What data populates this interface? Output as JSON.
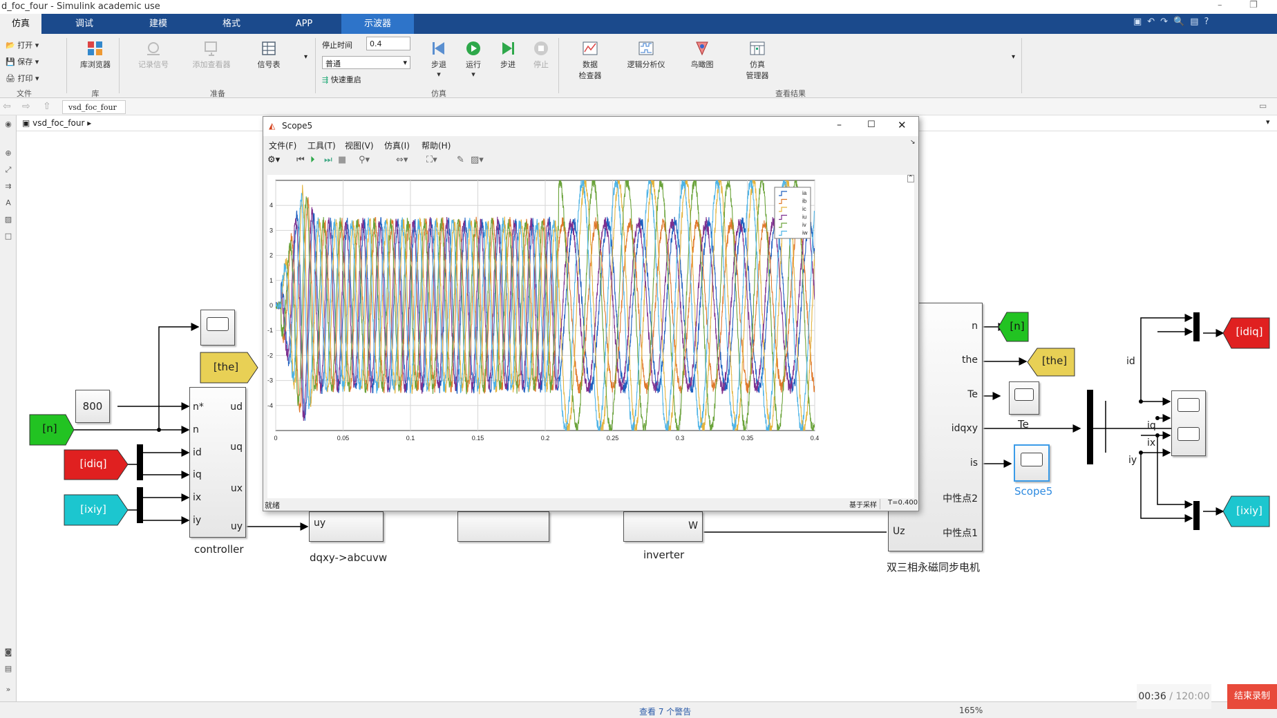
{
  "window_title": "d_foc_four - Simulink academic use",
  "tabs": [
    {
      "label": "仿真",
      "state": "active"
    },
    {
      "label": "调试",
      "state": "normal"
    },
    {
      "label": "建模",
      "state": "normal"
    },
    {
      "label": "格式",
      "state": "normal"
    },
    {
      "label": "APP",
      "state": "normal"
    },
    {
      "label": "示波器",
      "state": "highlight"
    }
  ],
  "ribbon": {
    "file": {
      "open": "打开",
      "save": "保存",
      "print": "打印",
      "label": "文件"
    },
    "library": {
      "browser": "库浏览器",
      "label": "库"
    },
    "prepare": {
      "log_signals": "记录信号",
      "add_viewer": "添加查看器",
      "signal_table": "信号表",
      "label": "准备"
    },
    "simulate": {
      "stop_time_label": "停止时间",
      "stop_time_value": "0.4",
      "mode_value": "普通",
      "fast_restart": "快速重启",
      "step_back": "步退",
      "run": "运行",
      "step_forward": "步进",
      "stop": "停止",
      "label": "仿真"
    },
    "review": {
      "data_inspector_line1": "数据",
      "data_inspector_line2": "检查器",
      "logic_analyzer": "逻辑分析仪",
      "bird_eye": "鸟瞰图",
      "sim_manager_line1": "仿真",
      "sim_manager_line2": "管理器",
      "label": "查看结果"
    }
  },
  "address": {
    "tab": "vsd_foc_four",
    "path": "vsd_foc_four"
  },
  "diagram": {
    "const_value": "800",
    "goto_n": "[n]",
    "goto_idiq": "[idiq]",
    "goto_ixiy": "[ixiy]",
    "goto_the": "[the]",
    "controller": {
      "name": "controller",
      "in": [
        "n*",
        "n",
        "id",
        "iq",
        "ix",
        "iy"
      ],
      "out": [
        "ud",
        "uq",
        "ux",
        "uy"
      ]
    },
    "dqxy_block": {
      "name": "dqxy->abcuvw",
      "port": "uy"
    },
    "inverter": {
      "name": "inverter",
      "port": "W"
    },
    "motor": {
      "name": "双三相永磁同步电机",
      "in": "Uz",
      "out": [
        "n",
        "the",
        "Te",
        "idqxy",
        "is",
        "中性点2",
        "中性点1"
      ]
    },
    "te_label": "Te",
    "scope5_label": "Scope5",
    "right": {
      "goto_n": "[n]",
      "goto_the": "[the]",
      "goto_idiq": "[idiq]",
      "goto_ixiy": "[ixiy]",
      "signals": [
        "id",
        "iq",
        "ix",
        "iy"
      ]
    }
  },
  "scope": {
    "title": "Scope5",
    "menus": [
      "文件(F)",
      "工具(T)",
      "视图(V)",
      "仿真(I)",
      "帮助(H)"
    ],
    "status_left": "就绪",
    "status_mid": "基于采样",
    "status_right": "T=0.400"
  },
  "chart_data": {
    "type": "line",
    "title": "",
    "xlabel": "",
    "ylabel": "",
    "xlim": [
      0,
      0.4
    ],
    "ylim": [
      -5,
      5
    ],
    "x_ticks": [
      "0",
      "0.05",
      "0.1",
      "0.15",
      "0.2",
      "0.25",
      "0.3",
      "0.35",
      "0.4"
    ],
    "y_ticks": [
      "4",
      "3",
      "2",
      "1",
      "0",
      "-1",
      "-2",
      "-3",
      "-4"
    ],
    "grid": true,
    "legend_position": "top-right",
    "series": [
      {
        "name": "ia",
        "color": "#1f5fbf",
        "amplitude": 3.3,
        "phase": 0
      },
      {
        "name": "ib",
        "color": "#e0782a",
        "amplitude": 3.3,
        "phase": 120
      },
      {
        "name": "ic",
        "color": "#e3b33c",
        "amplitude": 3.3,
        "phase": 240
      },
      {
        "name": "iu",
        "color": "#7e2f8e",
        "amplitude": 3.3,
        "phase": 30
      },
      {
        "name": "iv",
        "color": "#6aa33a",
        "amplitude": 3.3,
        "phase": 150
      },
      {
        "name": "iw",
        "color": "#4db3e6",
        "amplitude": 3.3,
        "phase": 270
      }
    ],
    "frequency_hz": {
      "before_0.21": 80,
      "after_0.21": 40
    },
    "noise_band": 0.25
  },
  "status": {
    "warnings": "查看 7 个警告",
    "zoom": "165%"
  },
  "recording": {
    "time": "00:36",
    "total": "/ 120:00",
    "end_button": "结束录制"
  },
  "colors": {
    "accent": "#1b4a8c",
    "tab_highlight": "#2e74c9",
    "goto_green": "#22c322",
    "goto_red": "#e02020",
    "goto_cyan": "#1cc6cf",
    "goto_yellow": "#e8d055"
  }
}
